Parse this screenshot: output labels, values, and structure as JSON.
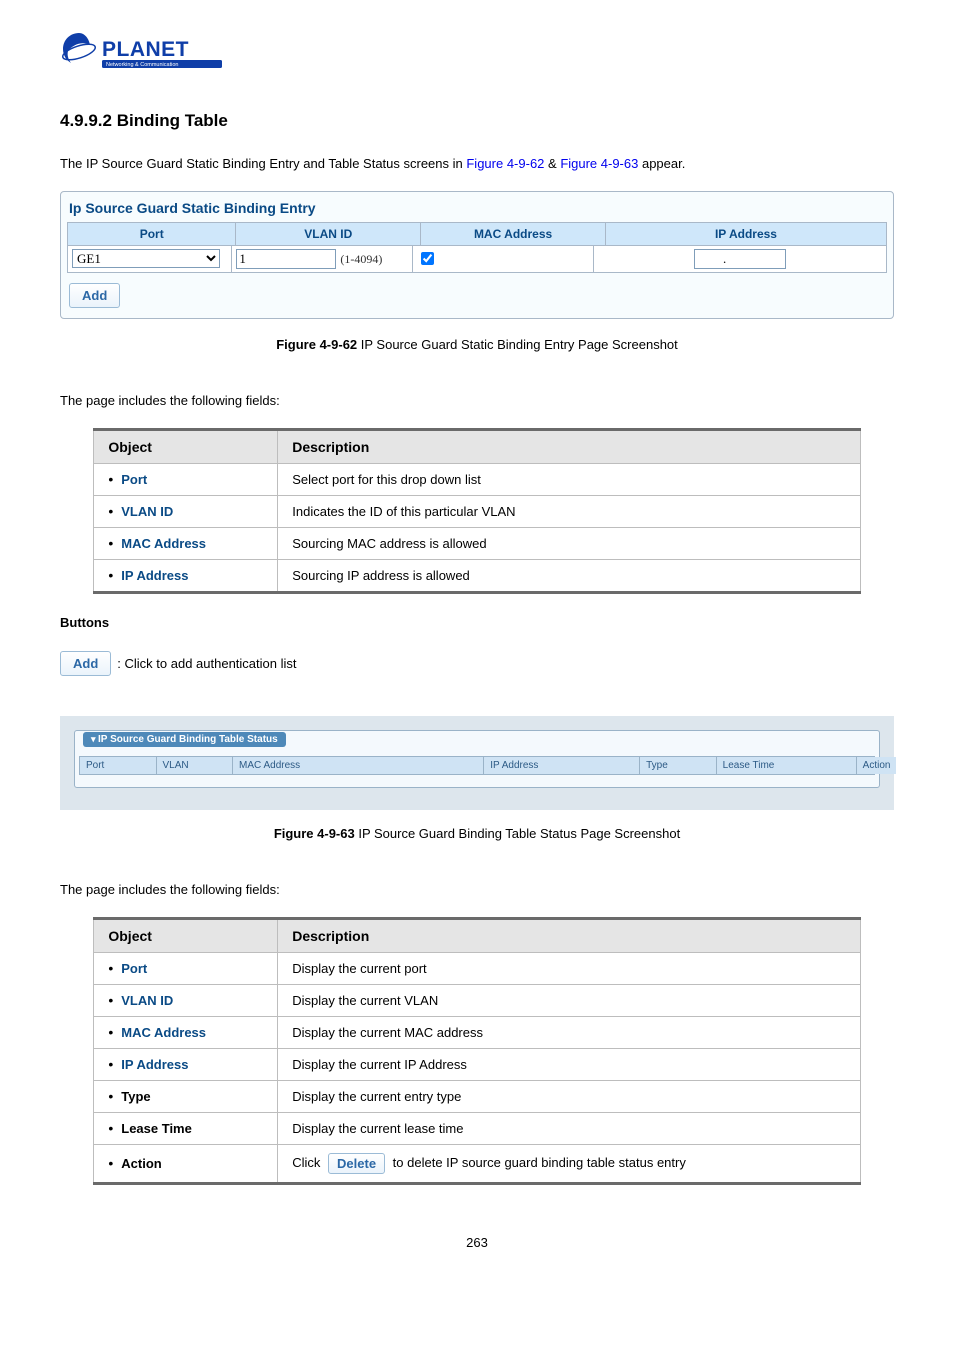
{
  "logo": {
    "brand": "PLANET",
    "tagline": "Networking & Communication"
  },
  "heading": "4.9.9.2 Binding Table",
  "intro": {
    "pre": "The IP Source Guard Static Binding Entry and Table Status screens in ",
    "link1": "Figure 4-9-62",
    "mid": " & ",
    "link2": "Figure 4-9-63",
    "post": " appear."
  },
  "entry": {
    "title": "Ip Source Guard Static Binding Entry",
    "cols": {
      "port": "Port",
      "vlan": "VLAN ID",
      "mac": "MAC Address",
      "ip": "IP Address"
    },
    "port_option": "GE1",
    "vlan_value": "1",
    "vlan_hint": "(1-4094)",
    "mac_checked": true,
    "add_btn": "Add"
  },
  "fig62": {
    "label": "Figure 4-9-62",
    "caption": " IP Source Guard Static Binding Entry Page Screenshot"
  },
  "fields_intro": "The page includes the following fields:",
  "table1": {
    "h1": "Object",
    "h2": "Description",
    "rows": [
      {
        "obj": "Port",
        "desc": "Select port for this drop down list"
      },
      {
        "obj": "VLAN ID",
        "desc": "Indicates the ID of this particular VLAN"
      },
      {
        "obj": "MAC Address",
        "desc": "Sourcing MAC address is allowed"
      },
      {
        "obj": "IP Address",
        "desc": "Sourcing IP address is allowed"
      }
    ]
  },
  "buttons_label": "Buttons",
  "addline": {
    "btn": "Add",
    "text": ": Click to add authentication list"
  },
  "status": {
    "title": "IP Source Guard Binding Table Status",
    "cols": {
      "port": "Port",
      "vlan": "VLAN",
      "mac": "MAC Address",
      "ip": "IP Address",
      "type": "Type",
      "lease": "Lease Time",
      "action": "Action"
    }
  },
  "fig63": {
    "label": "Figure 4-9-63",
    "caption": " IP Source Guard Binding Table Status Page Screenshot"
  },
  "table2": {
    "h1": "Object",
    "h2": "Description",
    "rows": [
      {
        "obj": "Port",
        "desc": "Display the current port"
      },
      {
        "obj": "VLAN ID",
        "desc": "Display the current VLAN"
      },
      {
        "obj": "MAC Address",
        "desc": "Display the current MAC address"
      },
      {
        "obj": "IP Address",
        "desc": "Display the current IP Address"
      },
      {
        "obj": "Type",
        "desc": "Display the current entry type"
      },
      {
        "obj": "Lease Time",
        "desc": "Display the current lease time"
      },
      {
        "obj": "Action",
        "pre": "Click ",
        "btn": "Delete",
        "post": " to delete IP source guard binding table status entry"
      }
    ]
  },
  "page_number": "263"
}
